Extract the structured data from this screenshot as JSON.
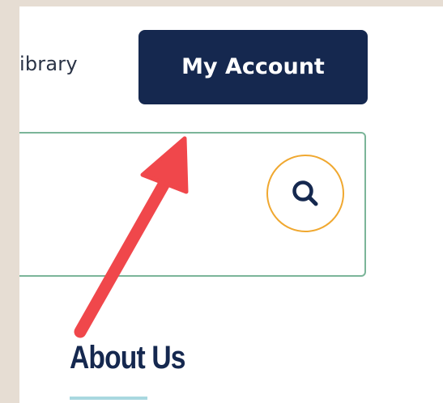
{
  "header": {
    "library_link": "ibrary",
    "account_button": "My Account"
  },
  "search": {
    "placeholder": ""
  },
  "section": {
    "heading": "About Us"
  },
  "colors": {
    "background": "#e6ddd3",
    "button_bg": "#15284f",
    "search_border": "#7bb599",
    "search_icon_ring": "#f0a830",
    "heading": "#15284f",
    "underline": "#a9d8e0",
    "annotation_arrow": "#f0474b"
  },
  "icons": {
    "search": "search-icon",
    "annotation": "annotation-arrow"
  }
}
